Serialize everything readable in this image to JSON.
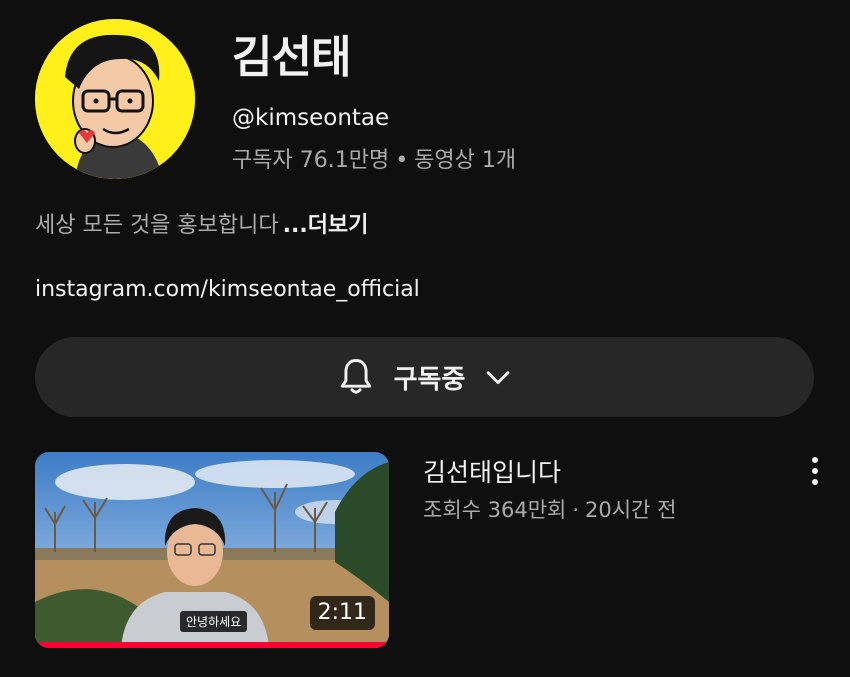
{
  "channel": {
    "name": "김선태",
    "handle": "@kimseontae",
    "subscribers": "구독자 76.1만명",
    "separator": "•",
    "videos": "동영상 1개",
    "description": "세상 모든 것을 홍보합니다",
    "more_label": "...더보기",
    "link": "instagram.com/kimseontae_official"
  },
  "subscribe": {
    "label": "구독중",
    "bell_icon": "bell-icon",
    "dropdown_icon": "chevron-down-icon"
  },
  "video": {
    "title": "김선태입니다",
    "views": "조회수 364만회",
    "separator": "·",
    "age": "20시간 전",
    "duration": "2:11",
    "caption": "안녕하세요",
    "watched_progress": 1.0,
    "menu_icon": "more-vert-icon"
  },
  "colors": {
    "background": "#0f0f0f",
    "avatar_bg": "#ffef1a",
    "button_bg": "#272727",
    "progress_red": "#ff0033",
    "secondary_text": "#aaaaaa"
  }
}
